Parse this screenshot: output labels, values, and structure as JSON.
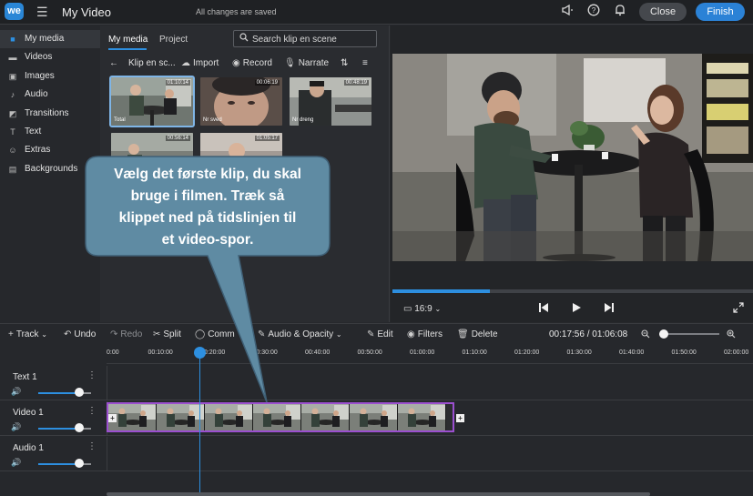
{
  "topbar": {
    "logo": "we",
    "title": "My Video",
    "save_status": "All changes are saved",
    "close_label": "Close",
    "finish_label": "Finish",
    "icons": [
      "megaphone-icon",
      "help-icon",
      "bell-icon"
    ]
  },
  "sidebar": {
    "items": [
      {
        "label": "My media",
        "icon": "folder-icon",
        "active": true
      },
      {
        "label": "Videos",
        "icon": "video-icon"
      },
      {
        "label": "Images",
        "icon": "image-icon"
      },
      {
        "label": "Audio",
        "icon": "music-note-icon"
      },
      {
        "label": "Transitions",
        "icon": "transitions-icon"
      },
      {
        "label": "Text",
        "icon": "text-icon"
      },
      {
        "label": "Extras",
        "icon": "smiley-icon"
      },
      {
        "label": "Backgrounds",
        "icon": "backgrounds-icon"
      }
    ]
  },
  "media": {
    "tabs": [
      "My media",
      "Project"
    ],
    "search_placeholder": "Search klip en scene",
    "toolbar": {
      "folder": "Klip en sc...",
      "import": "Import",
      "record": "Record",
      "narrate": "Narrate"
    },
    "clips": [
      {
        "name": "Total",
        "duration": "01:10:14"
      },
      {
        "name": "Nr sved",
        "duration": "00:06:19"
      },
      {
        "name": "Nr dreng",
        "duration": "00:48:19"
      },
      {
        "name": "",
        "duration": "00:56:14"
      },
      {
        "name": "",
        "duration": "01:05:17"
      }
    ]
  },
  "preview": {
    "aspect": "16:9",
    "progress_fraction": 0.27
  },
  "timeline": {
    "toolbar": {
      "track": "Track",
      "undo": "Undo",
      "redo": "Redo",
      "split": "Split",
      "comment": "Comm",
      "audio_opacity": "Audio & Opacity",
      "edit": "Edit",
      "filters": "Filters",
      "delete": "Delete"
    },
    "timecode": "00:17:56 / 01:06:08",
    "zoom_fraction": 0.0,
    "ruler": [
      "0:00",
      "00:10:00",
      "00:20:00",
      "00:30:00",
      "00:40:00",
      "00:50:00",
      "01:00:00",
      "01:10:00",
      "01:20:00",
      "01:30:00",
      "01:40:00",
      "01:50:00",
      "02:00:00"
    ],
    "tracks": [
      {
        "name": "Text 1",
        "volume": 0.77
      },
      {
        "name": "Video 1",
        "volume": 0.77
      },
      {
        "name": "Audio 1",
        "volume": 0.77
      }
    ],
    "playhead_time": "00:17:56"
  },
  "callout": {
    "lines": [
      "Vælg det første klip, du skal",
      "bruge i filmen. Træk så",
      "klippet ned på tidslinjen til",
      "et video-spor."
    ],
    "fill": "#5f8ba3",
    "stroke": "#3f5f75"
  }
}
